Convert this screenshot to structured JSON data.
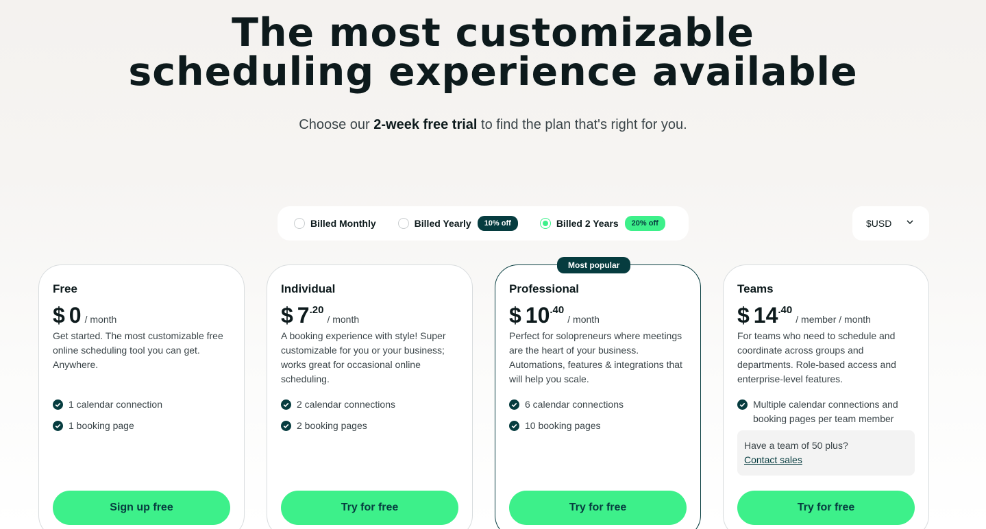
{
  "hero": {
    "title_line1": "The most customizable",
    "title_line2": "scheduling experience available",
    "subtitle_pre": "Choose our ",
    "subtitle_bold": "2-week free trial",
    "subtitle_post": " to find the plan that's right for you."
  },
  "billing": {
    "options": [
      {
        "label": "Billed Monthly",
        "selected": false,
        "badge": ""
      },
      {
        "label": "Billed Yearly",
        "selected": false,
        "badge": "10% off"
      },
      {
        "label": "Billed 2 Years",
        "selected": true,
        "badge": "20% off"
      }
    ]
  },
  "currency": {
    "value": "$USD",
    "icon": "chevron-down-icon"
  },
  "plans": [
    {
      "name": "Free",
      "currency_symbol": "$",
      "price": "0",
      "cents": "",
      "unit": "/ month",
      "description": "Get started. The most customizable free online scheduling tool you can get. Anywhere.",
      "features": [
        "1 calendar connection",
        "1 booking page"
      ],
      "cta": "Sign up free"
    },
    {
      "name": "Individual",
      "currency_symbol": "$",
      "price": "7",
      "cents": ".20",
      "unit": "/ month",
      "description": "A booking experience with style! Super customizable for you or your business; works great for occasional online scheduling.",
      "features": [
        "2 calendar connections",
        "2 booking pages"
      ],
      "cta": "Try for free"
    },
    {
      "name": "Professional",
      "badge": "Most popular",
      "currency_symbol": "$",
      "price": "10",
      "cents": ".40",
      "unit": "/ month",
      "description": "Perfect for solopreneurs where meetings are the heart of your business. Automations, features & integrations that will help you scale.",
      "features": [
        "6 calendar connections",
        "10 booking pages"
      ],
      "cta": "Try for free"
    },
    {
      "name": "Teams",
      "currency_symbol": "$",
      "price": "14",
      "cents": ".40",
      "unit": "/ member / month",
      "description": "For teams who need to schedule and coordinate across groups and departments. Role-based access and enterprise-level features.",
      "features": [
        "Multiple calendar connections and booking pages per team member"
      ],
      "team_note": "Have a team of 50 plus?",
      "team_link": "Contact sales",
      "cta": "Try for free"
    }
  ],
  "colors": {
    "accent": "#3df08a",
    "dark": "#063c3f",
    "text": "#0d1a1c"
  }
}
